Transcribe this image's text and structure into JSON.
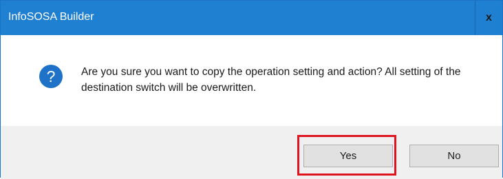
{
  "window": {
    "title": "InfoSOSA Builder",
    "close_glyph": "x"
  },
  "message": {
    "icon": "question-icon",
    "text": "Are you sure you want to copy the operation setting and action? All setting of the destination switch will be overwritten."
  },
  "buttons": {
    "yes_label": "Yes",
    "no_label": "No"
  },
  "colors": {
    "titlebar": "#1f7fd0",
    "icon": "#1e73c8",
    "highlight": "#e0141e",
    "footer": "#f0f0f0"
  }
}
